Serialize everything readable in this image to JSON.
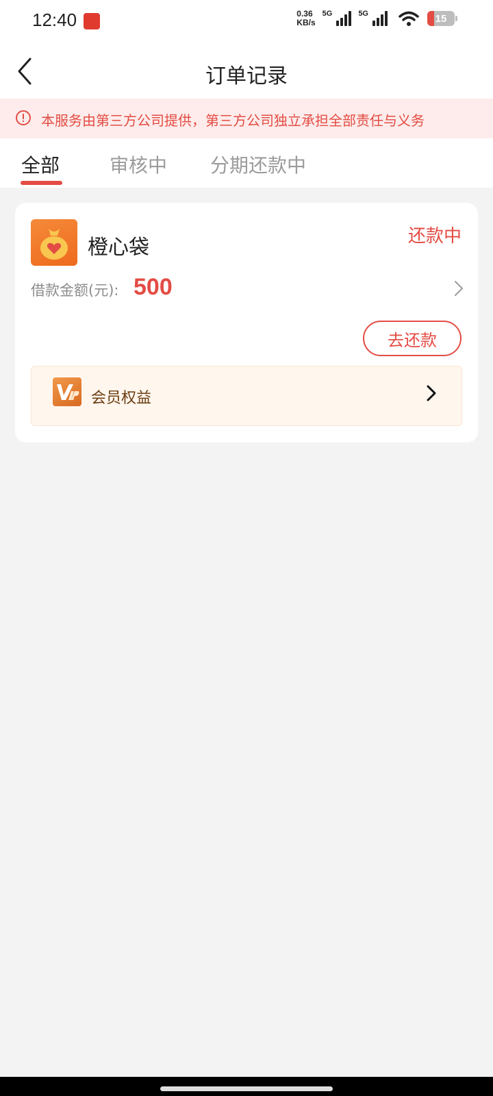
{
  "status_bar": {
    "time": "12:40",
    "net_speed_value": "0.36",
    "net_speed_unit": "KB/s",
    "signal1_label": "5G",
    "signal2_label": "5G",
    "battery": "15"
  },
  "header": {
    "title": "订单记录"
  },
  "notice": {
    "text": "本服务由第三方公司提供，第三方公司独立承担全部责任与义务"
  },
  "tabs": [
    {
      "label": "全部",
      "active": true
    },
    {
      "label": "审核中",
      "active": false
    },
    {
      "label": "分期还款中",
      "active": false
    }
  ],
  "order": {
    "product_name": "橙心袋",
    "status": "还款中",
    "amount_label": "借款金额(元):",
    "amount": "500",
    "repay_button": "去还款",
    "vip_label": "会员权益"
  },
  "colors": {
    "accent": "#e34c44",
    "notice_bg": "#fdeceb",
    "vip_bg": "#fff6ee",
    "page_bg": "#f3f3f3"
  },
  "icons": {
    "back": "chevron-left-icon",
    "notice": "alert-circle-icon",
    "product": "money-bag-heart-icon",
    "vip": "vip-badge-icon",
    "chevron": "chevron-right-icon"
  }
}
